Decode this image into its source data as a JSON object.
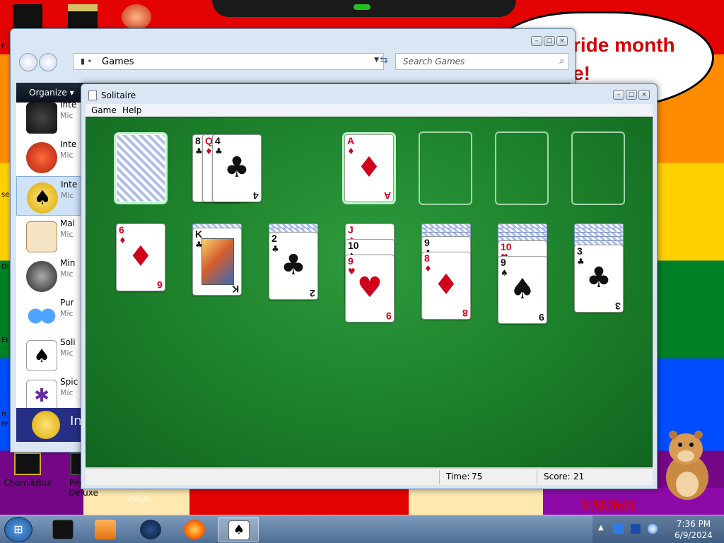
{
  "desktop": {
    "banner_text": "ride month\ne!",
    "signature": "VM0b01",
    "icons": [
      {
        "label": "ChomikBox"
      },
      {
        "label": "Peggle Deluxe"
      },
      {
        "label": "2016"
      }
    ],
    "side_labels": [
      "F",
      "se",
      "th",
      "Er",
      "n",
      "re"
    ]
  },
  "explorer": {
    "address": "Games",
    "search_placeholder": "Search Games",
    "toolbar_organize": "Organize ▾",
    "items": [
      {
        "name": "Inte",
        "publisher": "Mic"
      },
      {
        "name": "Inte",
        "publisher": "Mic"
      },
      {
        "name": "Inte",
        "publisher": "Mic"
      },
      {
        "name": "Mal",
        "publisher": "Mic"
      },
      {
        "name": "Min",
        "publisher": "Mic"
      },
      {
        "name": "Pur",
        "publisher": "Mic"
      },
      {
        "name": "Soli",
        "publisher": "Mic"
      },
      {
        "name": "Spic",
        "publisher": "Mic"
      }
    ],
    "details_title": "In"
  },
  "solitaire": {
    "title": "Solitaire",
    "menu": {
      "game": "Game",
      "help": "Help"
    },
    "status": {
      "time_label": "Time:",
      "time_value": "75",
      "score_label": "Score:",
      "score_value": "21"
    },
    "waste": [
      {
        "rank": "8",
        "suit": "♣",
        "color": "blk"
      },
      {
        "rank": "Q",
        "suit": "♦",
        "color": "red"
      },
      {
        "rank": "4",
        "suit": "♣",
        "color": "blk"
      }
    ],
    "foundations": [
      {
        "rank": "A",
        "suit": "♦",
        "color": "red"
      },
      null,
      null,
      null
    ],
    "tableau": [
      {
        "hidden": 0,
        "cards": [
          {
            "rank": "6",
            "suit": "♦",
            "color": "red"
          }
        ]
      },
      {
        "hidden": 1,
        "cards": [
          {
            "rank": "K",
            "suit": "♣",
            "color": "blk",
            "face": true
          }
        ]
      },
      {
        "hidden": 2,
        "cards": [
          {
            "rank": "2",
            "suit": "♣",
            "color": "blk"
          }
        ]
      },
      {
        "hidden": 0,
        "cards": [
          {
            "rank": "J",
            "suit": "♦",
            "color": "red",
            "face": true
          },
          {
            "rank": "10",
            "suit": "♠",
            "color": "blk"
          },
          {
            "rank": "9",
            "suit": "♥",
            "color": "red"
          }
        ]
      },
      {
        "hidden": 3,
        "cards": [
          {
            "rank": "9",
            "suit": "♣",
            "color": "blk"
          },
          {
            "rank": "8",
            "suit": "♦",
            "color": "red"
          }
        ]
      },
      {
        "hidden": 4,
        "cards": [
          {
            "rank": "10",
            "suit": "♥",
            "color": "red"
          },
          {
            "rank": "9",
            "suit": "♠",
            "color": "blk"
          }
        ]
      },
      {
        "hidden": 5,
        "cards": [
          {
            "rank": "3",
            "suit": "♣",
            "color": "blk"
          }
        ]
      }
    ]
  },
  "taskbar": {
    "clock_time": "7:36 PM",
    "clock_date": "6/9/2024"
  }
}
